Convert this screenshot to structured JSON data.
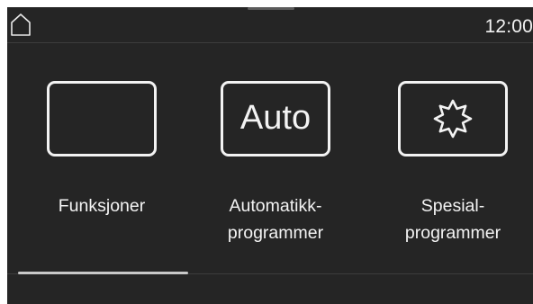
{
  "statusbar": {
    "time": "12:00",
    "home_icon": "home-icon"
  },
  "menu": {
    "items": [
      {
        "id": "functions",
        "label": "Funksjoner",
        "icon": "blank-frame-icon"
      },
      {
        "id": "auto",
        "label_line1": "Automatikk-",
        "label_line2": "programmer",
        "icon_text": "Auto",
        "icon": "auto-icon"
      },
      {
        "id": "special",
        "label_line1": "Spesial-",
        "label_line2": "programmer",
        "icon": "starburst-icon"
      }
    ]
  },
  "pager": {
    "pages": 3,
    "current": 1
  },
  "colors": {
    "background": "#252525",
    "foreground": "#f3f3f3",
    "divider": "#3d3d3d"
  }
}
